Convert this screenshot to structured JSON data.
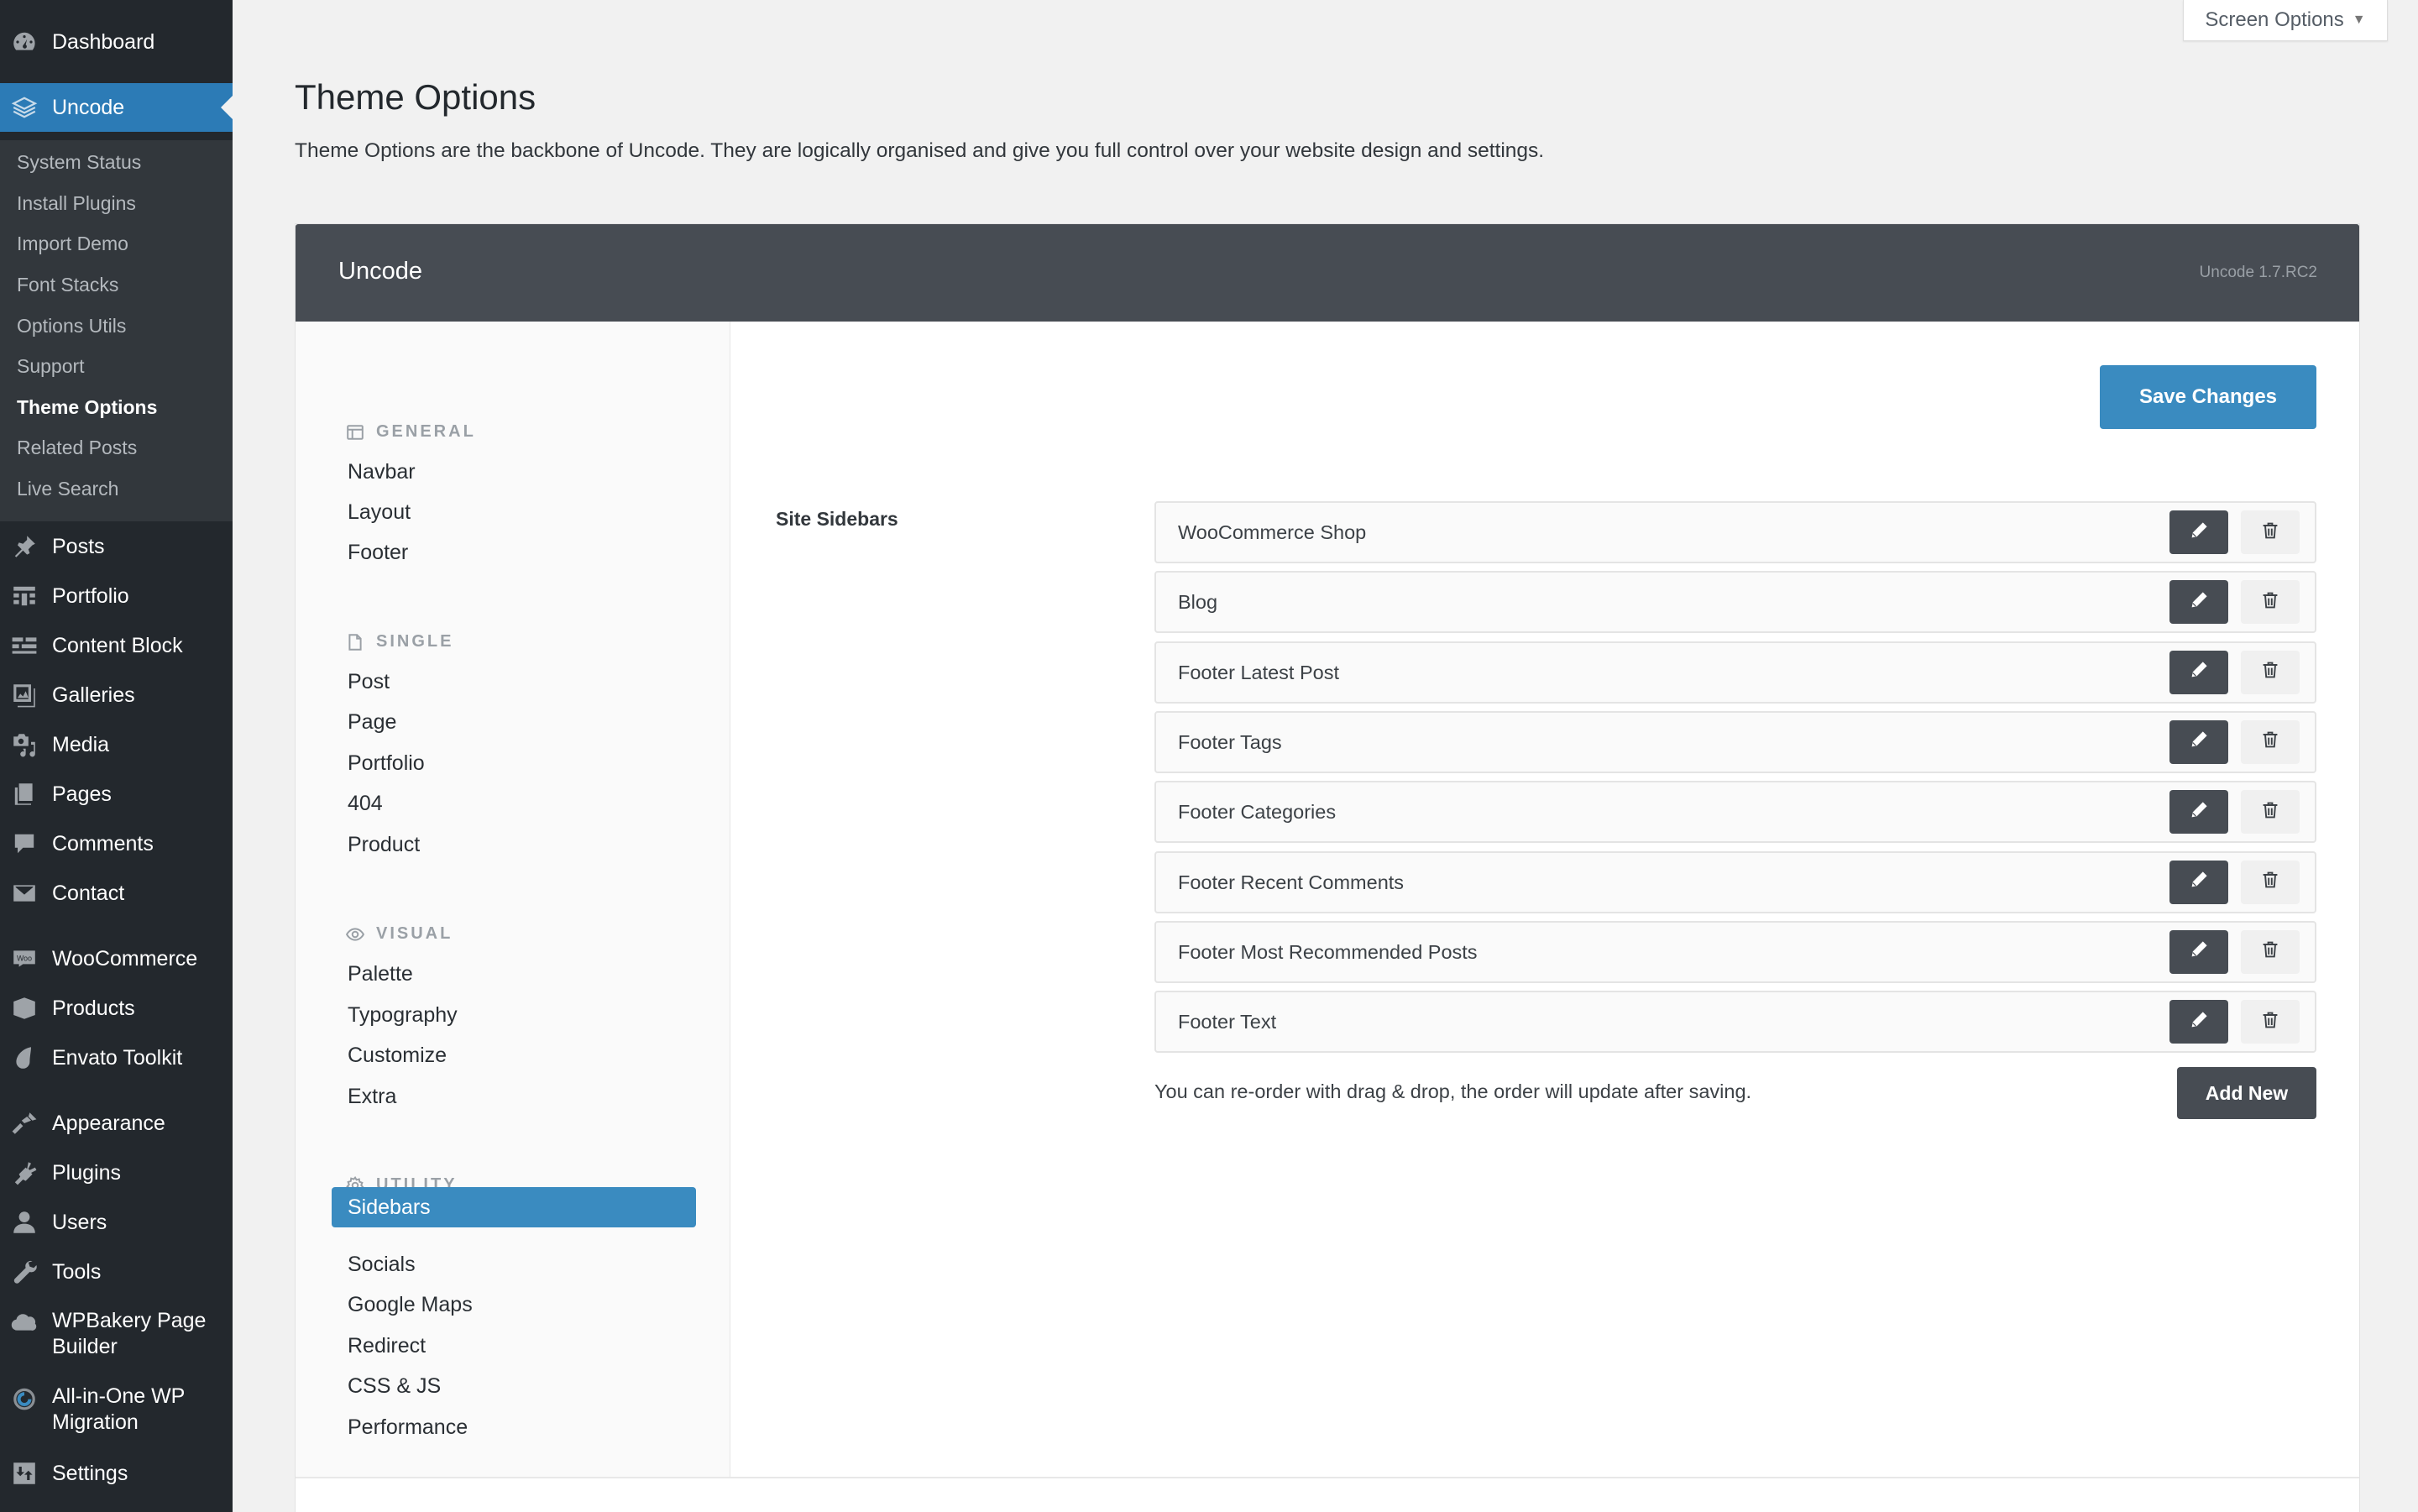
{
  "admin_menu": {
    "items": [
      {
        "label": "Dashboard",
        "icon": "dashboard-icon"
      },
      {
        "label": "Uncode",
        "icon": "layers-icon",
        "current": true
      },
      {
        "label": "Posts",
        "icon": "pin-icon"
      },
      {
        "label": "Portfolio",
        "icon": "portfolio-icon"
      },
      {
        "label": "Content Block",
        "icon": "content-block-icon"
      },
      {
        "label": "Galleries",
        "icon": "gallery-icon"
      },
      {
        "label": "Media",
        "icon": "media-icon"
      },
      {
        "label": "Pages",
        "icon": "pages-icon"
      },
      {
        "label": "Comments",
        "icon": "comment-icon"
      },
      {
        "label": "Contact",
        "icon": "envelope-icon"
      },
      {
        "label": "WooCommerce",
        "icon": "woo-icon"
      },
      {
        "label": "Products",
        "icon": "box-icon"
      },
      {
        "label": "Envato Toolkit",
        "icon": "envato-icon"
      },
      {
        "label": "Appearance",
        "icon": "brush-icon"
      },
      {
        "label": "Plugins",
        "icon": "plug-icon"
      },
      {
        "label": "Users",
        "icon": "user-icon"
      },
      {
        "label": "Tools",
        "icon": "wrench-icon"
      },
      {
        "label": "WPBakery Page Builder",
        "icon": "cloud-icon"
      },
      {
        "label": "All-in-One WP Migration",
        "icon": "migration-icon"
      },
      {
        "label": "Settings",
        "icon": "settings-icon"
      }
    ],
    "submenu": [
      {
        "label": "System Status"
      },
      {
        "label": "Install Plugins"
      },
      {
        "label": "Import Demo"
      },
      {
        "label": "Font Stacks"
      },
      {
        "label": "Options Utils"
      },
      {
        "label": "Support"
      },
      {
        "label": "Theme Options",
        "active": true
      },
      {
        "label": "Related Posts"
      },
      {
        "label": "Live Search"
      }
    ]
  },
  "screen_options": {
    "label": "Screen Options"
  },
  "page": {
    "title": "Theme Options",
    "description": "Theme Options are the backbone of Uncode. They are logically organised and give you full control over your website design and settings."
  },
  "panel": {
    "title": "Uncode",
    "version": "Uncode 1.7.RC2",
    "save_label": "Save Changes",
    "nav": {
      "general": {
        "heading": "GENERAL",
        "items": [
          "Navbar",
          "Layout",
          "Footer"
        ]
      },
      "single": {
        "heading": "SINGLE",
        "items": [
          "Post",
          "Page",
          "Portfolio",
          "404",
          "Product"
        ]
      },
      "visual": {
        "heading": "VISUAL",
        "items": [
          "Palette",
          "Typography",
          "Customize",
          "Extra"
        ]
      },
      "utility": {
        "heading": "UTILITY",
        "items": [
          "Sidebars",
          "Socials",
          "Google Maps",
          "Redirect",
          "CSS & JS",
          "Performance"
        ],
        "active": "Sidebars"
      }
    },
    "section_label": "Site Sidebars",
    "sidebars": [
      "WooCommerce Shop",
      "Blog",
      "Footer Latest Post",
      "Footer Tags",
      "Footer Categories",
      "Footer Recent Comments",
      "Footer Most Recommended Posts",
      "Footer Text"
    ],
    "hint": "You can re-order with drag & drop, the order will update after saving.",
    "add_new_label": "Add New"
  },
  "colors": {
    "admin_bg": "#23282d",
    "submenu_bg": "#32373c",
    "current_blue": "#2c7bb6",
    "accent_blue": "#3a8bc0",
    "dark_button": "#474c53"
  }
}
